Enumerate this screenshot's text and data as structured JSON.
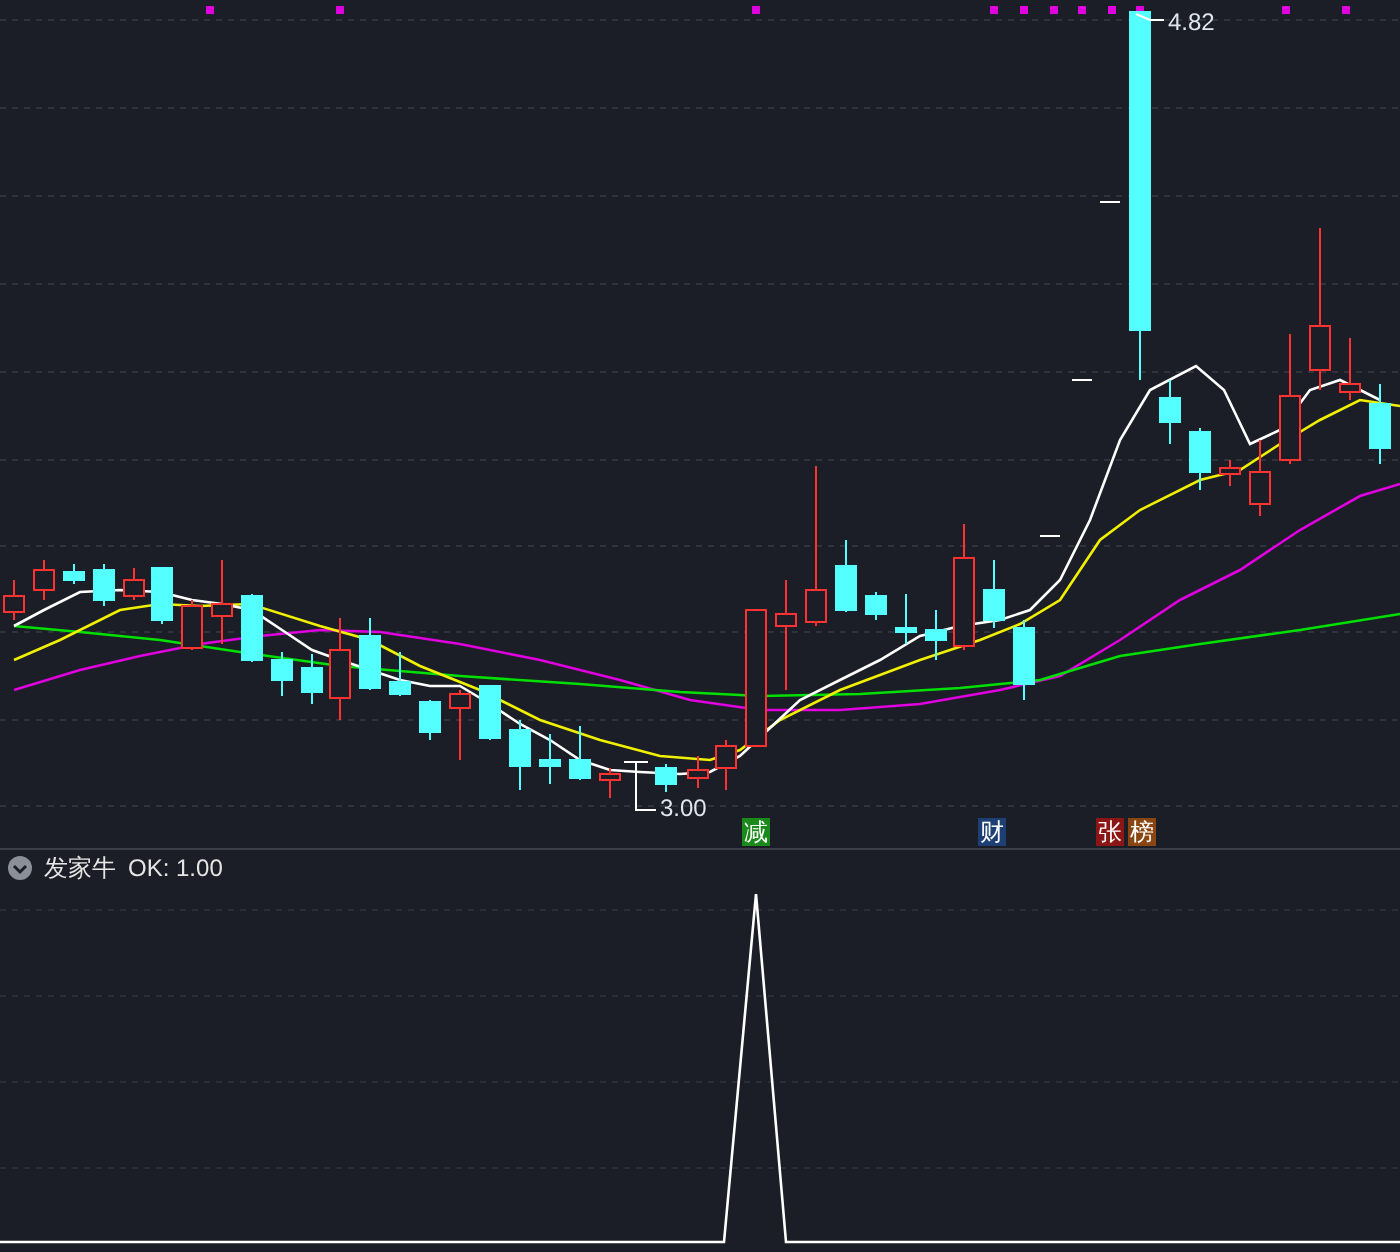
{
  "price_chart": {
    "high_label": "4.82",
    "low_label": "3.00",
    "markers": [
      {
        "text": "减",
        "color": "#1a8a1a"
      },
      {
        "text": "财",
        "color": "#1d3f73"
      },
      {
        "text": "张",
        "color": "#8c1616"
      },
      {
        "text": "榜",
        "color": "#8a4612"
      }
    ]
  },
  "indicator": {
    "name": "发家牛",
    "reading": "OK: 1.00"
  }
}
